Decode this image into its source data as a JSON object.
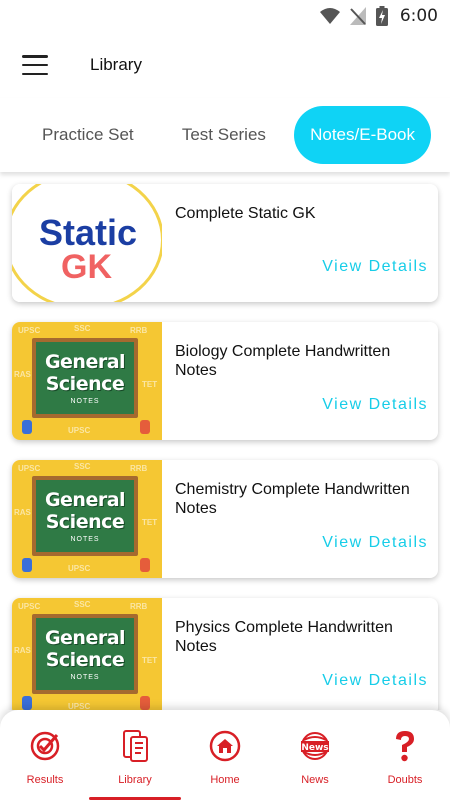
{
  "status_bar": {
    "time": "6:00"
  },
  "app_bar": {
    "title": "Library"
  },
  "tabs": [
    {
      "label": "Practice Set",
      "active": false
    },
    {
      "label": "Test Series",
      "active": false
    },
    {
      "label": "Notes/E-Book",
      "active": true
    }
  ],
  "items": [
    {
      "title": "Complete Static GK",
      "action": "View Details",
      "thumb": {
        "line1": "Static",
        "line2": "GK"
      }
    },
    {
      "title": "Biology Complete Handwritten Notes",
      "action": "View Details",
      "thumb": {
        "line1": "General",
        "line2": "Science",
        "line3": "NOTES"
      }
    },
    {
      "title": "Chemistry Complete Handwritten Notes",
      "action": "View Details",
      "thumb": {
        "line1": "General",
        "line2": "Science",
        "line3": "NOTES"
      }
    },
    {
      "title": "Physics Complete Handwritten Notes",
      "action": "View Details",
      "thumb": {
        "line1": "General",
        "line2": "Science",
        "line3": "NOTES"
      }
    }
  ],
  "thumb_deco": [
    "UPSC",
    "SSC",
    "RRB",
    "RAS",
    "TET",
    "UPSC"
  ],
  "bottom_nav": [
    {
      "label": "Results",
      "icon": "results-target-icon",
      "active": false
    },
    {
      "label": "Library",
      "icon": "library-book-icon",
      "active": true
    },
    {
      "label": "Home",
      "icon": "home-icon",
      "active": false
    },
    {
      "label": "News",
      "icon": "news-icon",
      "active": false
    },
    {
      "label": "Doubts",
      "icon": "question-mark-icon",
      "active": false
    }
  ],
  "colors": {
    "accent": "#0fd3f5",
    "link": "#17cde8",
    "nav": "#d81f26"
  }
}
